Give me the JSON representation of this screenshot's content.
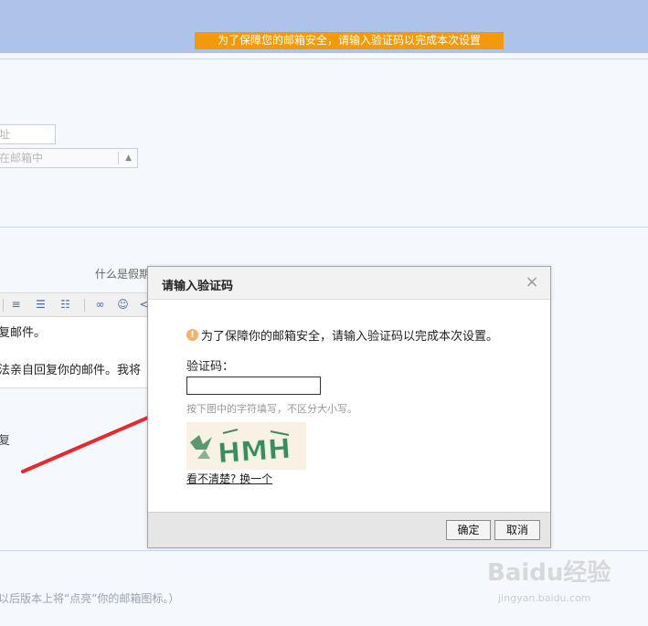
{
  "banner": {
    "text": "为了保障您的邮箱安全，请输入验证码以完成本次设置"
  },
  "background": {
    "input_placeholder": "址",
    "select_value": "在邮箱中",
    "help_link": "什么是假期",
    "editor_line1": "复邮件。",
    "editor_line2": "法亲自回复你的邮件。我将",
    "reply_label": "复",
    "footer_note": "以后版本上将“点亮”你的邮箱图标。）"
  },
  "dialog": {
    "title": "请输入验证码",
    "close": "×",
    "info_icon": "!",
    "info_text": "为了保障你的邮箱安全，请输入验证码以完成本次设置。",
    "code_label": "验证码：",
    "code_value": "",
    "hint": "按下图中的字符填写，不区分大小写。",
    "captcha_text": "HMH",
    "refresh_link": "看不清楚? 换一个",
    "ok_label": "确定",
    "cancel_label": "取消"
  },
  "watermark": {
    "brand": "Baidu经验",
    "url": "jingyan.baidu.com"
  },
  "colors": {
    "top_band": "#adc3ea",
    "banner_orange": "#f29a0c",
    "arrow_red": "#e8282d",
    "captcha_green": "#3d8a5a"
  }
}
